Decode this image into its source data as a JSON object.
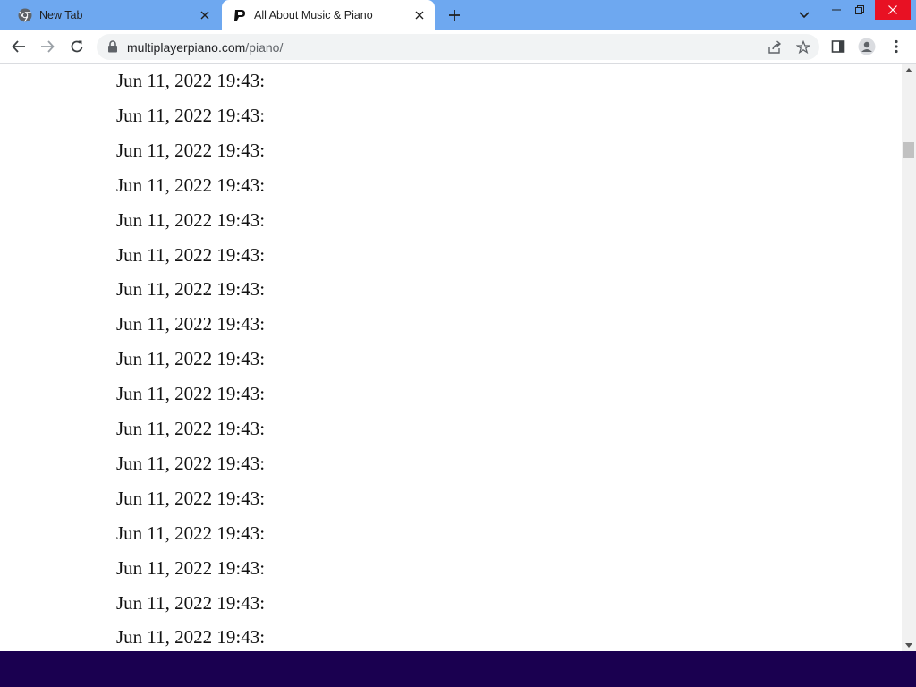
{
  "browser": {
    "tabs": [
      {
        "title": "New Tab",
        "favicon": "chrome-icon",
        "active": false
      },
      {
        "title": "All About Music & Piano",
        "favicon": "piano-logo-icon",
        "active": true
      }
    ],
    "address": {
      "domain": "multiplayerpiano.com",
      "path": "/piano/"
    },
    "colors": {
      "tabstrip": "#6ea8f0",
      "close_button": "#e81123",
      "bottom_band": "#1a0050"
    }
  },
  "page": {
    "log_lines": [
      "Jun 11, 2022 19:43:",
      "Jun 11, 2022 19:43:",
      "Jun 11, 2022 19:43:",
      "Jun 11, 2022 19:43:",
      "Jun 11, 2022 19:43:",
      "Jun 11, 2022 19:43:",
      "Jun 11, 2022 19:43:",
      "Jun 11, 2022 19:43:",
      "Jun 11, 2022 19:43:",
      "Jun 11, 2022 19:43:",
      "Jun 11, 2022 19:43:",
      "Jun 11, 2022 19:43:",
      "Jun 11, 2022 19:43:",
      "Jun 11, 2022 19:43:",
      "Jun 11, 2022 19:43:",
      "Jun 11, 2022 19:43:",
      "Jun 11, 2022 19:43:"
    ]
  }
}
